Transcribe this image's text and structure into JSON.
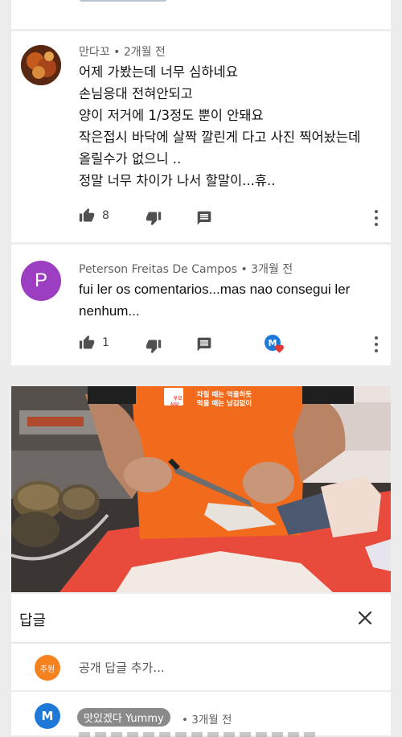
{
  "comments": [
    {
      "author": "만다꼬",
      "time": "2개월 전",
      "lines": [
        "어제 가봤는데 너무 심하네요",
        "손님응대 전혀안되고",
        "양이 저거에 1/3정도 뿐이 안돼요",
        "작은접시 바닥에 살짝 깔린게 다고 사진 찍어놨는데",
        "올릴수가 없으니 ..",
        "정말 너무 차이가 나서 할말이...휴.."
      ],
      "likes": "8"
    },
    {
      "author": "Peterson Freitas De Campos",
      "time": "3개월 전",
      "avatar_letter": "P",
      "lines": [
        "fui ler os comentarios...mas nao consegui ler",
        "nenhum..."
      ],
      "likes": "1",
      "creator_heart_letter": "M"
    }
  ],
  "video": {
    "logo_text": "우오\n식당",
    "banner_line1": "차릴 때는 억울하듯",
    "banner_line2": "먹을 때는 남김없이"
  },
  "replies_panel": {
    "title": "답글",
    "add_reply_avatar": "주원",
    "add_reply_placeholder": "공개 답글 추가...",
    "reply_author_badge": "맛있겠다 Yummy",
    "reply_avatar_letter": "M",
    "reply_time": "3개월 전"
  },
  "colors": {
    "peterson_avatar": "#9c3ec1",
    "joowon_avatar": "#f5821f",
    "yummy_avatar": "#1e78d8",
    "heart": "#e53935",
    "apron": "#f26a1b",
    "cutting_board": "#e84a3c"
  }
}
